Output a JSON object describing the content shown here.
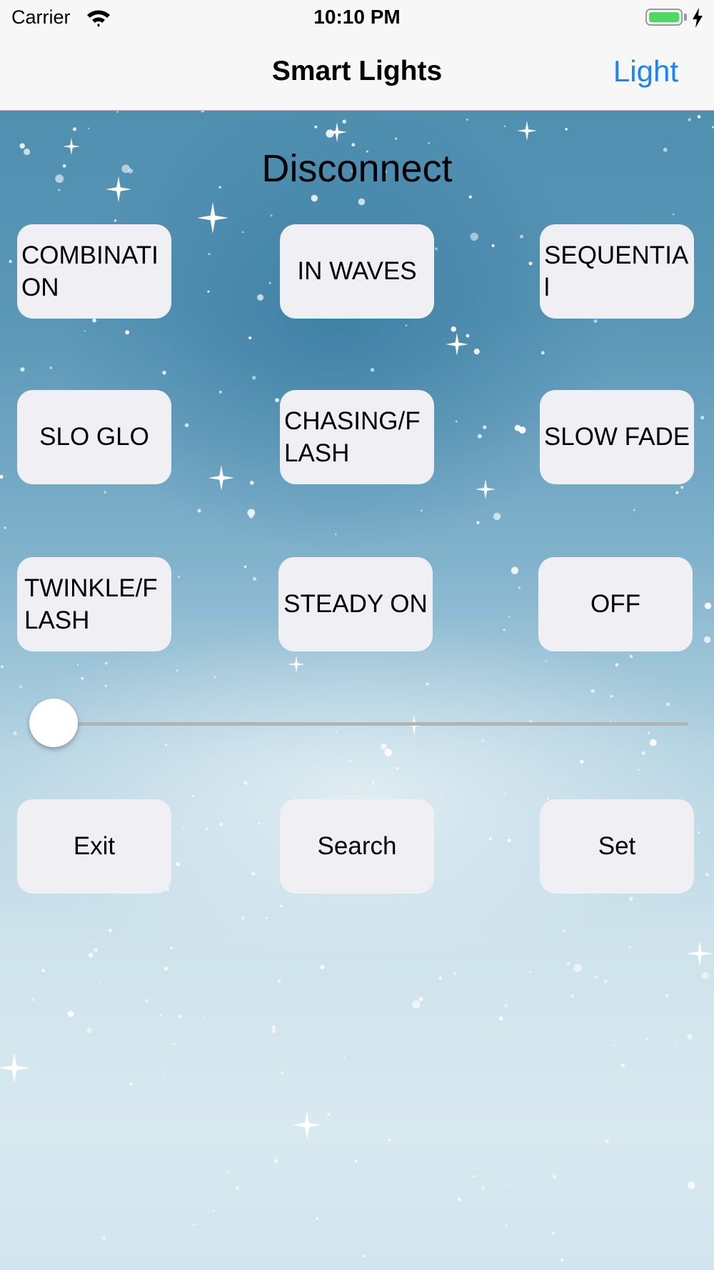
{
  "status_bar": {
    "carrier": "Carrier",
    "time": "10:10 PM",
    "battery_level": 1.0,
    "battery_color": "#4cd964",
    "charging": true
  },
  "nav": {
    "title": "Smart Lights",
    "right_button": "Light",
    "accent_color": "#1a84ff"
  },
  "main": {
    "heading": "Disconnect",
    "modes": [
      "COMBINATION",
      "IN WAVES",
      "SEQUENTIAl",
      "SLO GLO",
      "CHASING/FLASH",
      "SLOW FADE",
      "TWINKLE/FLASH",
      "STEADY ON",
      "OFF"
    ],
    "slider_value": 0.0,
    "actions": {
      "exit": "Exit",
      "search": "Search",
      "set": "Set"
    }
  }
}
